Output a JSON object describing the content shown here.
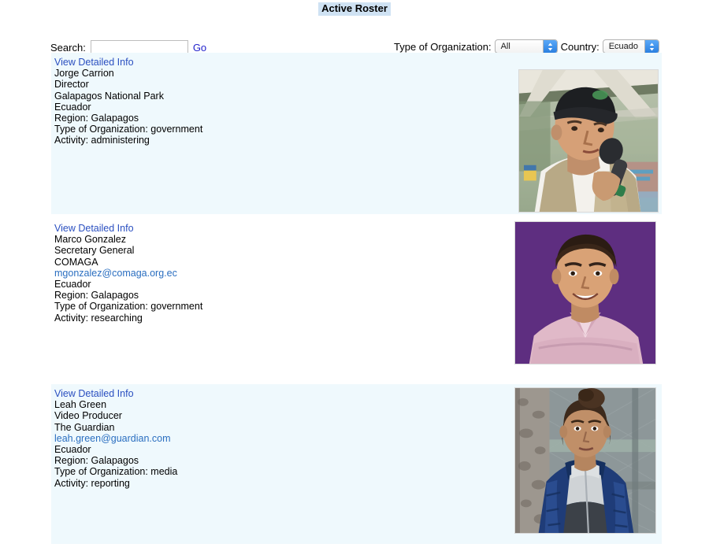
{
  "page": {
    "title": "Active Roster",
    "title_highlight_color": "#cfe2f3",
    "background_color": "#ffffff"
  },
  "search": {
    "label": "Search:",
    "value": "",
    "placeholder": "",
    "go_label": "Go"
  },
  "filters": {
    "org": {
      "label": "Type of Organization:",
      "selected": "All"
    },
    "country": {
      "label": "Country:",
      "selected": "Ecuado"
    }
  },
  "roster": {
    "link_label": "View Detailed Info",
    "card_shaded_color": "#eff9fd",
    "link_color": "#2a4fc0",
    "email_color": "#2a6ec0",
    "entries": [
      {
        "link": "View Detailed Info",
        "name": "Jorge Carrion",
        "role": "Director",
        "organization": "Galapagos National Park",
        "email": "",
        "country": "Ecuador",
        "region": "Region: Galapagos",
        "org_type": "Type of Organization: government",
        "activity": "Activity: administering",
        "photo": "man-with-cap-speaking-into-microphone"
      },
      {
        "link": "View Detailed Info",
        "name": "Marco Gonzalez",
        "role": "Secretary General",
        "organization": "COMAGA",
        "email": "mgonzalez@comaga.org.ec",
        "country": "Ecuador",
        "region": "Region: Galapagos",
        "org_type": "Type of Organization: government",
        "activity": "Activity: researching",
        "photo": "smiling-man-pink-shirt-purple-background"
      },
      {
        "link": "View Detailed Info",
        "name": "Leah Green",
        "role": "Video Producer",
        "organization": "The Guardian",
        "email": "leah.green@guardian.com",
        "country": "Ecuador",
        "region": "Region: Galapagos",
        "org_type": "Type of Organization: media",
        "activity": "Activity: reporting",
        "photo": "woman-blue-puffer-jacket-fence-background"
      }
    ]
  }
}
